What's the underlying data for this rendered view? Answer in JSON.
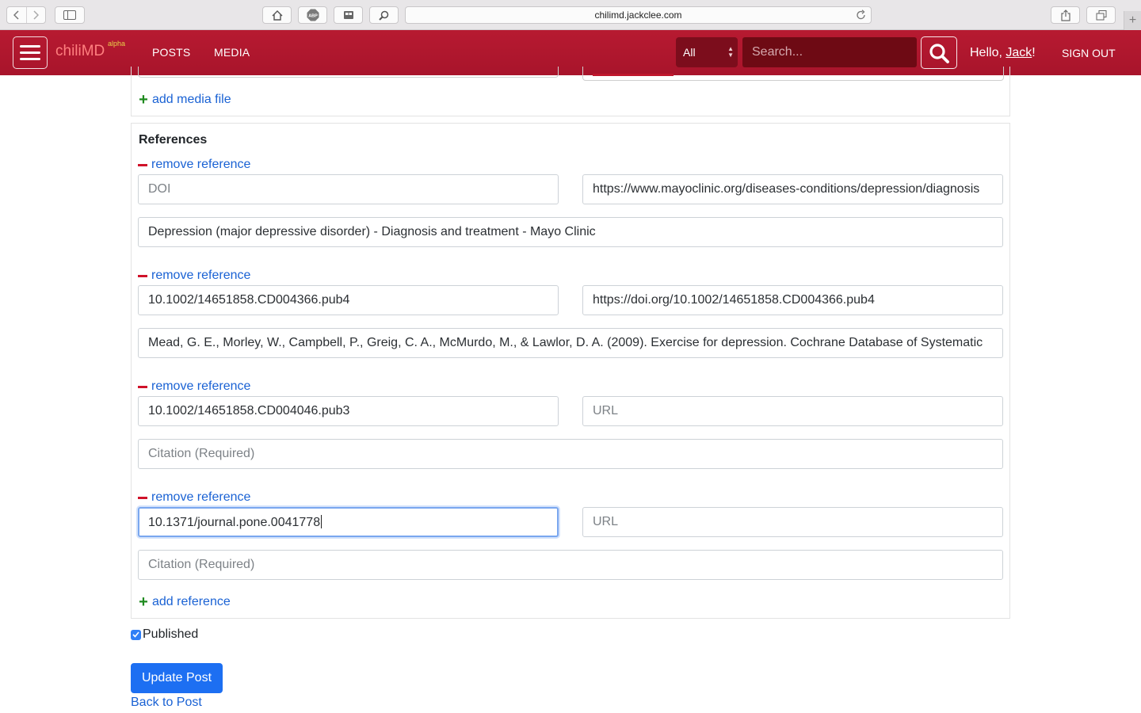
{
  "browser": {
    "url": "chilimd.jackclee.com"
  },
  "navbar": {
    "brand": "chiliMD",
    "brand_badge": "alpha",
    "links": [
      "POSTS",
      "MEDIA"
    ],
    "search_scope": "All",
    "search_placeholder": "Search...",
    "greeting_prefix": "Hello, ",
    "user_name": "Jack",
    "greeting_suffix": "!",
    "sign_out": "SIGN OUT"
  },
  "media": {
    "add_media_label": "add media file"
  },
  "references": {
    "title": "References",
    "remove_label": "remove reference",
    "add_label": "add reference",
    "items": [
      {
        "doi": "",
        "doi_placeholder": "DOI",
        "url": "https://www.mayoclinic.org/diseases-conditions/depression/diagnosis",
        "url_placeholder": "URL",
        "citation": "Depression (major depressive disorder) - Diagnosis and treatment - Mayo Clinic",
        "citation_placeholder": "Citation (Required)"
      },
      {
        "doi": "10.1002/14651858.CD004366.pub4",
        "doi_placeholder": "DOI",
        "url": "https://doi.org/10.1002/14651858.CD004366.pub4",
        "url_placeholder": "URL",
        "citation": "Mead, G. E., Morley, W., Campbell, P., Greig, C. A., McMurdo, M., & Lawlor, D. A. (2009). Exercise for depression. Cochrane Database of Systematic",
        "citation_placeholder": "Citation (Required)"
      },
      {
        "doi": "10.1002/14651858.CD004046.pub3",
        "doi_placeholder": "DOI",
        "url": "",
        "url_placeholder": "URL",
        "citation": "",
        "citation_placeholder": "Citation (Required)"
      },
      {
        "doi": "10.1371/journal.pone.0041778",
        "doi_placeholder": "DOI",
        "url": "",
        "url_placeholder": "URL",
        "citation": "",
        "citation_placeholder": "Citation (Required)"
      }
    ]
  },
  "form": {
    "published_label": "Published",
    "published_checked": true,
    "submit_label": "Update Post",
    "back_label": "Back to Post"
  }
}
